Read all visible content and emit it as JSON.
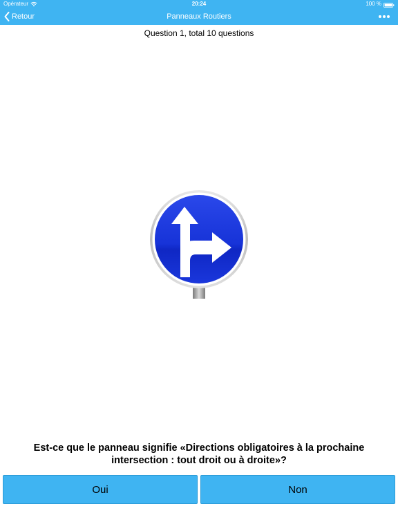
{
  "status_bar": {
    "carrier": "Opérateur",
    "time": "20:24",
    "battery": "100 %"
  },
  "nav": {
    "back_label": "Retour",
    "title": "Panneaux Routiers"
  },
  "quiz": {
    "progress": "Question 1, total 10 questions",
    "question": "Est-ce que le panneau signifie «Directions obligatoires à la prochaine intersection : tout droit ou à droite»?",
    "yes_label": "Oui",
    "no_label": "Non"
  },
  "sign": {
    "icon": "mandatory-straight-or-right-sign",
    "color": "#1e3de0"
  },
  "colors": {
    "accent": "#3fb4f2"
  }
}
